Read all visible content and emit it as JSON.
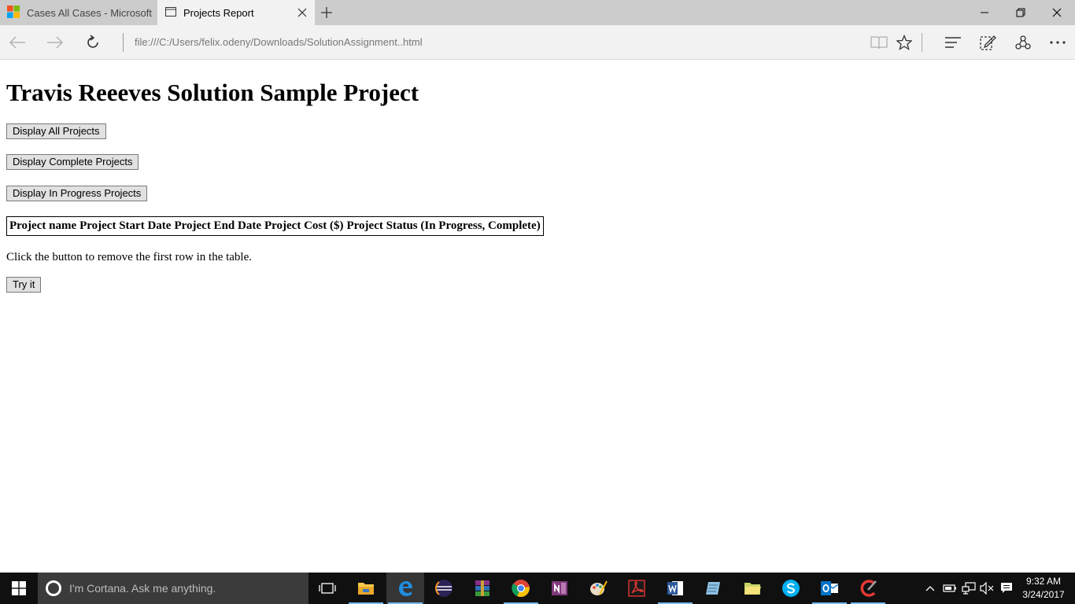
{
  "browser": {
    "tabs": [
      {
        "title": "Cases All Cases - Microsoft",
        "icon": "microsoft-logo-icon",
        "active": false
      },
      {
        "title": "Projects Report",
        "icon": "page-icon",
        "active": true
      }
    ],
    "address": "file:///C:/Users/felix.odeny/Downloads/SolutionAssignment..html"
  },
  "page": {
    "heading": "Travis Reeeves Solution Sample Project",
    "buttons": {
      "all": "Display All Projects",
      "complete": "Display Complete Projects",
      "in_progress": "Display In Progress Projects",
      "try_it": "Try it"
    },
    "table": {
      "headers": [
        "Project name",
        "Project Start Date",
        "Project End Date",
        "Project Cost ($)",
        "Project Status (In Progress, Complete)"
      ]
    },
    "instruction": "Click the button to remove the first row in the table."
  },
  "taskbar": {
    "search_placeholder": "I'm Cortana. Ask me anything.",
    "apps": [
      "task-view-icon",
      "file-explorer-icon",
      "edge-icon",
      "eclipse-icon",
      "winrar-icon",
      "chrome-icon",
      "onenote-icon",
      "paint-icon",
      "acrobat-icon",
      "word-icon",
      "notepad-icon",
      "folder-icon",
      "skype-icon",
      "outlook-icon",
      "ccleaner-icon"
    ],
    "time": "9:32 AM",
    "date": "3/24/2017"
  },
  "colors": {
    "tab_strip": "#cccccc",
    "address_bar": "#f2f2f2",
    "taskbar": "#101010",
    "cortana_box": "#3b3b3b",
    "edge_blue": "#0078d7"
  }
}
